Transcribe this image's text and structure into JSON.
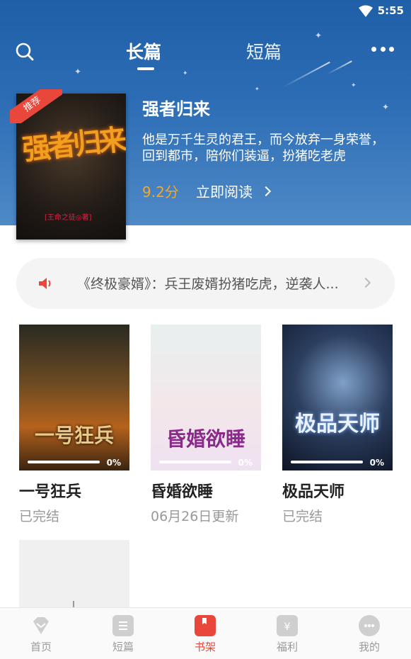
{
  "status_bar": {
    "time": "5:55"
  },
  "header": {
    "tabs": [
      {
        "label": "长篇",
        "active": true
      },
      {
        "label": "短篇",
        "active": false
      }
    ]
  },
  "featured": {
    "badge": "推荐",
    "cover_text": "强者归来",
    "cover_author": "[王命之徒◎著]",
    "title": "强者归来",
    "description": "他是万千生灵的君王，而今放弃一身荣誉，回到都市，陪你们装逼，扮猪吃老虎",
    "score": "9.2分",
    "read_now": "立即阅读"
  },
  "announcement": {
    "text": "《终极豪婿》：兵王废婿扮猪吃虎，逆袭人..."
  },
  "books": [
    {
      "title": "一号狂兵",
      "status": "已完结",
      "progress": "0%",
      "cover_text": "一号狂兵"
    },
    {
      "title": "昏婚欲睡",
      "status": "06月26日更新",
      "progress": "0%",
      "cover_text": "昏婚欲睡"
    },
    {
      "title": "极品天师",
      "status": "已完结",
      "progress": "0%",
      "cover_text": "极品天师"
    }
  ],
  "bottom_nav": [
    {
      "label": "首页",
      "icon": "home-diamond-icon",
      "active": false
    },
    {
      "label": "短篇",
      "icon": "document-icon",
      "active": false
    },
    {
      "label": "书架",
      "icon": "bookshelf-icon",
      "active": true
    },
    {
      "label": "福利",
      "icon": "coin-icon",
      "active": false
    },
    {
      "label": "我的",
      "icon": "chat-bubble-icon",
      "active": false
    }
  ],
  "colors": {
    "accent": "#e9473c",
    "score": "#f5a623",
    "header_blue": "#2c6db5"
  }
}
